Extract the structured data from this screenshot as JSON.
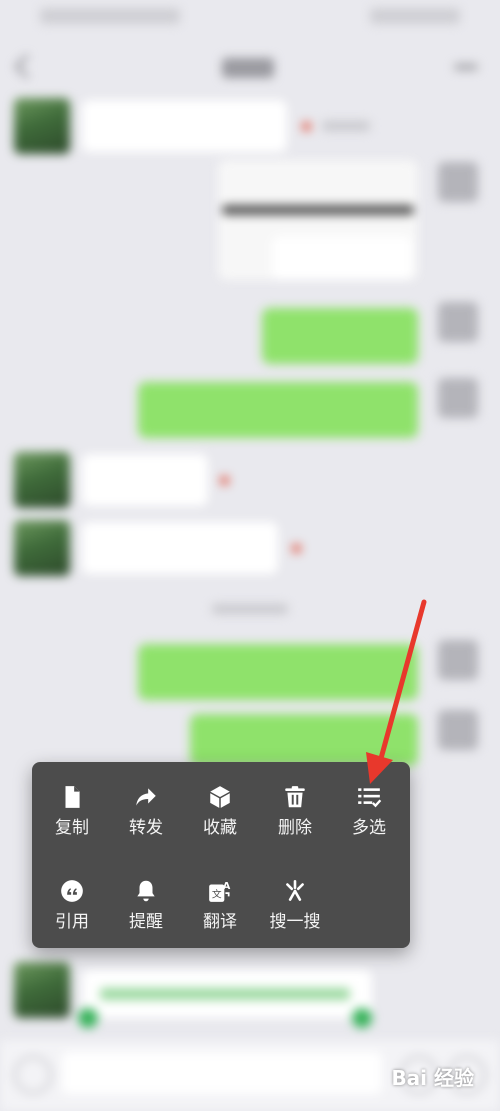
{
  "context_menu": {
    "row1": [
      {
        "label": "复制",
        "icon": "copy-icon"
      },
      {
        "label": "转发",
        "icon": "forward-icon"
      },
      {
        "label": "收藏",
        "icon": "favorite-icon"
      },
      {
        "label": "删除",
        "icon": "trash-icon"
      },
      {
        "label": "多选",
        "icon": "multi-select-icon"
      }
    ],
    "row2": [
      {
        "label": "引用",
        "icon": "quote-icon"
      },
      {
        "label": "提醒",
        "icon": "bell-icon"
      },
      {
        "label": "翻译",
        "icon": "translate-icon"
      },
      {
        "label": "搜一搜",
        "icon": "search-sparkle-icon"
      }
    ]
  },
  "watermark": "Bai 经验",
  "colors": {
    "menu_bg": "#4c4c4c",
    "bubble_green": "#8fe26b",
    "annotation_red": "#e8382c"
  }
}
